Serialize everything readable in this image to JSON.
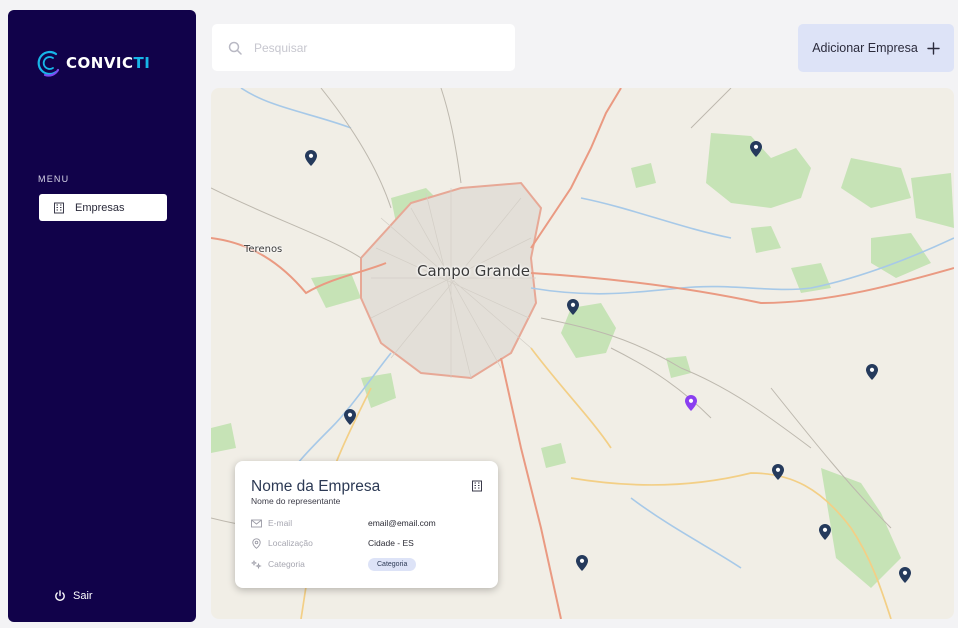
{
  "sidebar": {
    "logo_text": "CONVIC",
    "logo_accent": "TI",
    "menu_label": "MENU",
    "items": [
      {
        "label": "Empresas",
        "icon": "building-icon"
      }
    ],
    "logout_label": "Sair",
    "bg_color": "#11024a",
    "accent_color": "#17b6e8"
  },
  "search": {
    "placeholder": "Pesquisar",
    "value": ""
  },
  "add_button": {
    "label": "Adicionar Empresa",
    "icon": "plus-icon"
  },
  "map": {
    "city_label": "Campo Grande",
    "town_label": "Terenos",
    "marker_color": "#253a5c",
    "selected_marker_color": "#8a3ff0"
  },
  "card": {
    "title": "Nome da Empresa",
    "subtitle": "Nome do representante",
    "email_label": "E-mail",
    "email_value": "email@email.com",
    "location_label": "Localização",
    "location_value": "Cidade - ES",
    "category_label": "Categoria",
    "category_value": "Categoria"
  }
}
